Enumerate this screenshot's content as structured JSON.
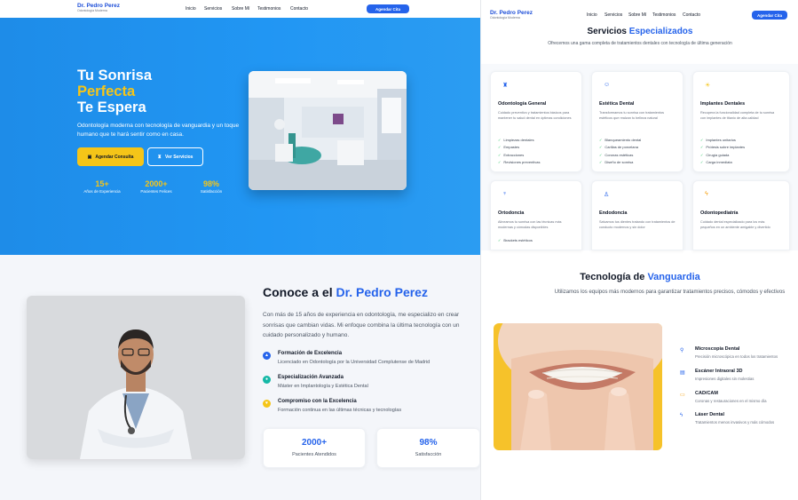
{
  "left": {
    "nav": {
      "logo_title": "Dr. Pedro Perez",
      "logo_sub": "Odontología Moderna",
      "links": [
        "Inicio",
        "Servicios",
        "Sobre Mí",
        "Testimonios",
        "Contacto"
      ],
      "cta": "Agendar Cita"
    },
    "hero": {
      "title_1": "Tu Sonrisa",
      "title_2": "Perfecta",
      "title_3": "Te Espera",
      "subtitle": "Odontología moderna con tecnología de vanguardia y un toque humano que te hará sentir como en casa.",
      "btn_primary": "Agendar Consulta",
      "btn_secondary": "Ver Servicios",
      "stats": [
        {
          "value": "15+",
          "label": "Años de Experiencia"
        },
        {
          "value": "2000+",
          "label": "Pacientes Felices"
        },
        {
          "value": "98%",
          "label": "Satisfacción"
        }
      ]
    },
    "about": {
      "title_pre": "Conoce a el ",
      "title_name": "Dr. Pedro Perez",
      "intro": "Con más de 15 años de experiencia en odontología, me especializo en crear sonrisas que cambian vidas. Mi enfoque combina la última tecnología con un cuidado personalizado y humano.",
      "items": [
        {
          "title": "Formación de Excelencia",
          "desc": "Licenciado en Odontología por la Universidad Complutense de Madrid",
          "icon": "graduation-cap-icon"
        },
        {
          "title": "Especialización Avanzada",
          "desc": "Máster en Implantología y Estética Dental",
          "icon": "medal-icon"
        },
        {
          "title": "Compromiso con la Excelencia",
          "desc": "Formación continua en las últimas técnicas y tecnologías",
          "icon": "heart-icon"
        }
      ],
      "stats": [
        {
          "value": "2000+",
          "label": "Pacientes Atendidos"
        },
        {
          "value": "98%",
          "label": "Satisfacción"
        }
      ]
    }
  },
  "right": {
    "nav": {
      "logo_title": "Dr. Pedro Perez",
      "logo_sub": "Odontología Moderna",
      "links": [
        "Inicio",
        "Servicios",
        "Sobre Mí",
        "Testimonios",
        "Contacto"
      ],
      "cta": "Agendar Cita"
    },
    "services": {
      "title_pre": "Servicios ",
      "title_hl": "Especializados",
      "subtitle": "Ofrecemos una gama completa de tratamientos dentales con tecnología de última generación",
      "cards": [
        {
          "icon": "tooth-icon",
          "title": "Odontología General",
          "desc": "Cuidado preventivo y tratamientos básicos para mantener tu salud dental en óptimas condiciones",
          "features": [
            "Limpiezas dentales",
            "Empastes",
            "Extracciones",
            "Revisiones preventivas"
          ]
        },
        {
          "icon": "smile-icon",
          "title": "Estética Dental",
          "desc": "Transformamos tu sonrisa con tratamientos estéticos que realzan tu belleza natural",
          "features": [
            "Blanqueamiento dental",
            "Carillas de porcelana",
            "Coronas estéticas",
            "Diseño de sonrisa"
          ]
        },
        {
          "icon": "sun-icon",
          "title": "Implantes Dentales",
          "desc": "Recupera la funcionalidad completa de tu sonrisa con implantes de titanio de alta calidad",
          "features": [
            "Implantes unitarios",
            "Prótesis sobre implantes",
            "Cirugía guiada",
            "Carga inmediata"
          ]
        },
        {
          "icon": "braces-icon",
          "title": "Ortodoncia",
          "desc": "Alineamos tu sonrisa con las técnicas más modernas y cómodas disponibles",
          "features": [
            "Brackets estéticos"
          ]
        },
        {
          "icon": "user-icon",
          "title": "Endodoncia",
          "desc": "Salvamos tus dientes tratando con tratamientos de conducto modernos y sin dolor",
          "features": []
        },
        {
          "icon": "bolt-icon",
          "title": "Odontopediatría",
          "desc": "Cuidado dental especializado para los más pequeños en un ambiente amigable y divertido",
          "features": []
        }
      ]
    },
    "tech": {
      "title_pre": "Tecnología de ",
      "title_hl": "Vanguardia",
      "subtitle": "Utilizamos los equipos más modernos para garantizar tratamientos precisos, cómodos y efectivos",
      "items": [
        {
          "icon": "microscope-icon",
          "title": "Microscopía Dental",
          "desc": "Precisión microscópica en todos los tratamientos"
        },
        {
          "icon": "scanner-icon",
          "title": "Escáner Intraoral 3D",
          "desc": "Impresiones digitales sin molestias"
        },
        {
          "icon": "monitor-icon",
          "title": "CAD/CAM",
          "desc": "Coronas y restauraciones en el mismo día"
        },
        {
          "icon": "bolt-icon",
          "title": "Láser Dental",
          "desc": "Tratamientos menos invasivos y más cómodos"
        }
      ]
    }
  },
  "colors": {
    "primary": "#2563eb",
    "accent": "#f5c518",
    "check": "#22c55e"
  }
}
